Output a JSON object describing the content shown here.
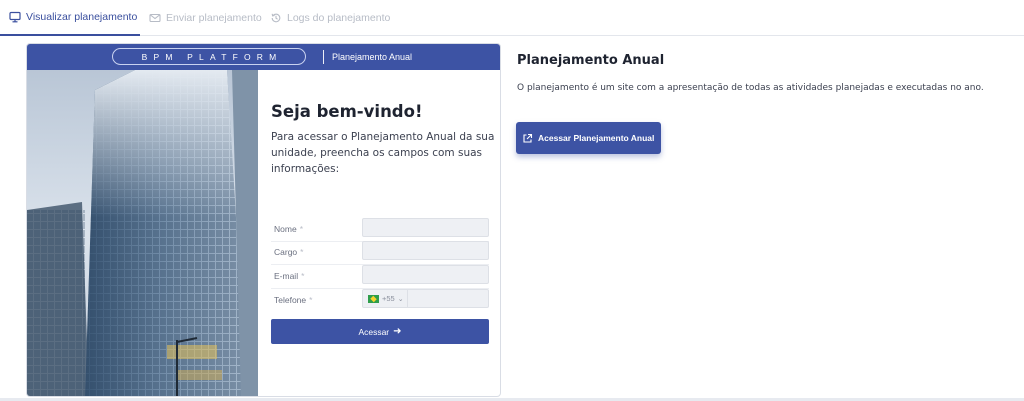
{
  "tabs": [
    {
      "label": "Visualizar planejamento",
      "icon": "monitor-icon",
      "active": true
    },
    {
      "label": "Enviar planejamento",
      "icon": "mail-icon",
      "active": false
    },
    {
      "label": "Logs do planejamento",
      "icon": "history-icon",
      "active": false
    }
  ],
  "card": {
    "brand": "BPM PLATFORM",
    "header_title": "Planejamento Anual",
    "welcome": "Seja bem-vindo!",
    "intro": "Para acessar o Planejamento Anual da sua unidade, preencha os campos com suas informações:",
    "fields": [
      {
        "label": "Nome",
        "required_mark": "*"
      },
      {
        "label": "Cargo",
        "required_mark": "*"
      },
      {
        "label": "E-mail",
        "required_mark": "*"
      },
      {
        "label": "Telefone",
        "required_mark": "*"
      }
    ],
    "phone_prefix": "+55",
    "submit_label": "Acessar"
  },
  "right": {
    "title": "Planejamento Anual",
    "description": "O planejamento é um site com a apresentação de todas as atividades planejadas e executadas no ano.",
    "button_label": "Acessar Planejamento Anual",
    "button_icon": "external-link-icon"
  },
  "colors": {
    "accent": "#3d53a4",
    "tab_inactive": "#b7bcc6",
    "input_bg": "#eef0f4"
  }
}
